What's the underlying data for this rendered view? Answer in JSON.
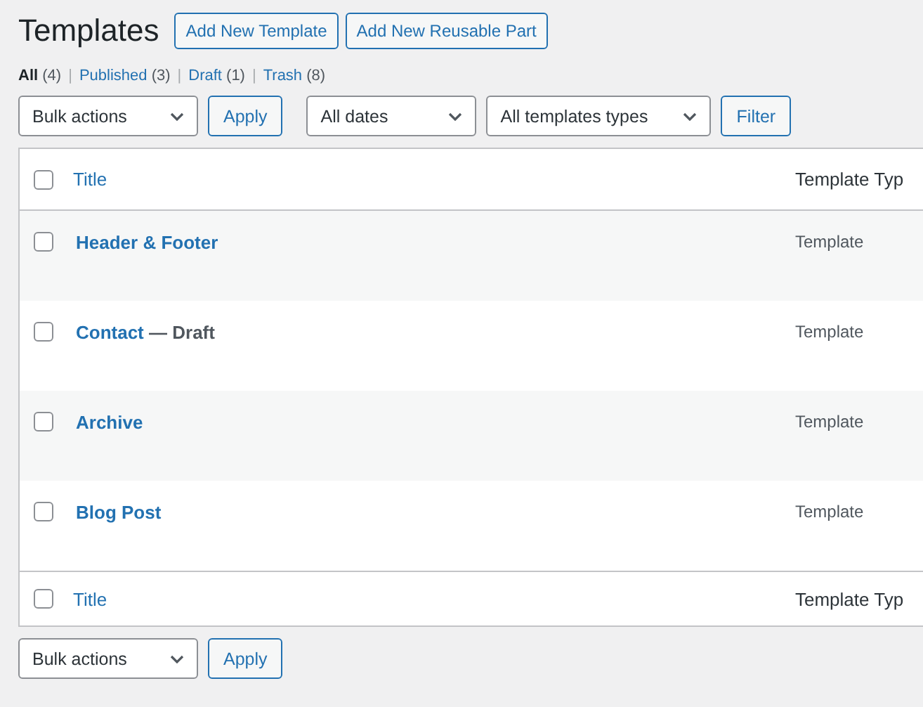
{
  "page_title": "Templates",
  "header_buttons": [
    "Add New Template",
    "Add New Reusable Part"
  ],
  "status_separator": "|",
  "status_links": [
    {
      "label": "All",
      "count": "(4)",
      "selected": true
    },
    {
      "label": "Published",
      "count": "(3)",
      "selected": false
    },
    {
      "label": "Draft",
      "count": "(1)",
      "selected": false
    },
    {
      "label": "Trash",
      "count": "(8)",
      "selected": false
    }
  ],
  "top_filters": {
    "bulk_select": "Bulk actions",
    "apply": "Apply",
    "date_select": "All dates",
    "type_select": "All templates types",
    "filter": "Filter"
  },
  "table": {
    "header": {
      "checked": false,
      "title": "Title",
      "column_2": "Template Typ"
    },
    "rows": [
      {
        "checked": false,
        "title": "Header & Footer",
        "type": "Template"
      },
      {
        "checked": false,
        "title": "Contact",
        "state": "— Draft",
        "type": "Template"
      },
      {
        "checked": false,
        "title": "Archive",
        "type": "Template"
      },
      {
        "checked": false,
        "title": "Blog Post",
        "type": "Template"
      }
    ],
    "footer": {
      "checked": false,
      "title": "Title",
      "column_2": "Template Typ"
    }
  },
  "bottom_filters": {
    "bulk_select": "Bulk actions",
    "apply": "Apply"
  }
}
